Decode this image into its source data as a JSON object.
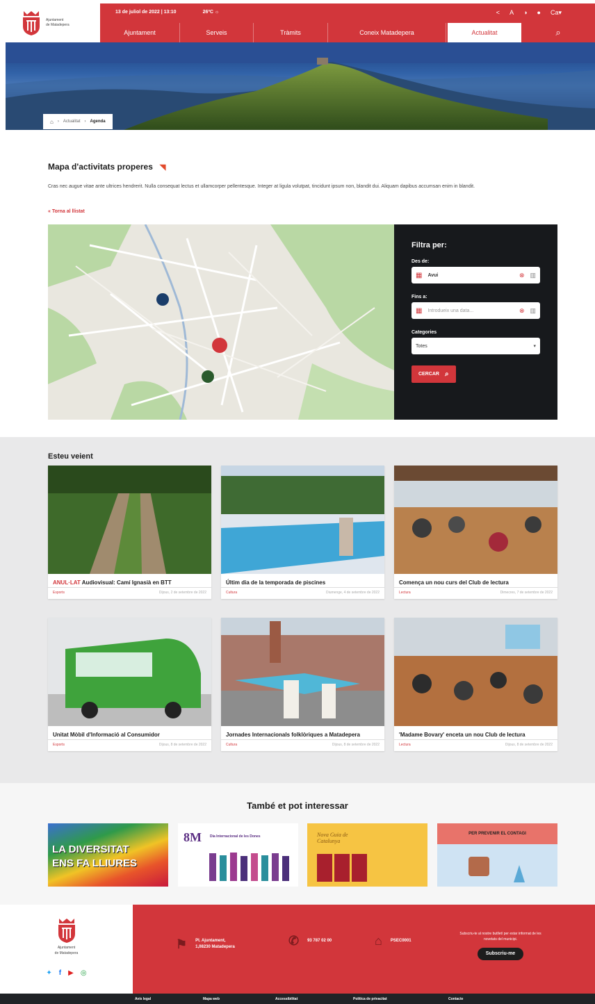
{
  "header": {
    "logo_text": [
      "Ajuntament",
      "de Matadepera"
    ],
    "date": "13 de juliol de 2022 | 13:10",
    "weather": "26ºC",
    "lang": "Ca",
    "nav": [
      "Ajuntament",
      "Serveis",
      "Tràmits",
      "Coneix Matadepera",
      "Actualitat"
    ],
    "active_nav": "Actualitat"
  },
  "breadcrumb": [
    "Actualitat",
    "Agenda"
  ],
  "map_section": {
    "title": "Mapa d'activitats properes",
    "description": "Cras nec augue vitae ante ultrices hendrerit. Nulla consequat lectus et ullamcorper pellentesque. Integer at ligula volutpat, tincidunt ipsum non, blandit dui. Aliquam dapibus accumsan enim in blandit.",
    "back_link": "« Torna al llistat"
  },
  "filter": {
    "title": "Filtra per:",
    "from_label": "Des de:",
    "from_value": "Avui",
    "to_label": "Fins a:",
    "to_placeholder": "Introdueix una data...",
    "categories_label": "Categories",
    "categories_value": "Totes",
    "search_button": "CERCAR"
  },
  "seeing": {
    "title": "Esteu veient",
    "cards": [
      {
        "tag": "ANUL·LAT",
        "title": "Audiovisual: Camí Ignasià en BTT",
        "category": "Esports",
        "date": "Dijous, 2 de setembre de 2022"
      },
      {
        "tag": "",
        "title": "Últim dia de la temporada de piscines",
        "category": "Cultura",
        "date": "Diumenge, 4 de setembre de 2022"
      },
      {
        "tag": "",
        "title": "Comença un nou curs del Club de lectura",
        "category": "Lectura",
        "date": "Dimecres, 7 de setembre de 2022"
      },
      {
        "tag": "",
        "title": "Unitat Mòbil d'Informació al Consumidor",
        "category": "Esports",
        "date": "Dijous, 8 de setembre de 2022"
      },
      {
        "tag": "",
        "title": "Jornades Internacionals folklòriques a Matadepera",
        "category": "Cultura",
        "date": "Dijous, 8 de setembre de 2022"
      },
      {
        "tag": "",
        "title": "'Madame Bovary' enceta un nou Club de lectura",
        "category": "Lectura",
        "date": "Dijous, 8 de setembre de 2022"
      }
    ]
  },
  "interest": {
    "title": "També et pot interessar",
    "promos": [
      {
        "text": [
          "LA DIVERSITAT",
          "ENS FA LLIURES"
        ]
      },
      {
        "text": [
          "8M",
          "Dia Internacional de les Dones"
        ]
      },
      {
        "text": [
          "Nova Guia de Catalunya"
        ]
      },
      {
        "text": [
          "PER PREVENIR EL CONTAGI"
        ]
      }
    ]
  },
  "footer": {
    "logo_text": [
      "Ajuntament",
      "de Matadepera"
    ],
    "address": [
      "Pl. Ajuntament,",
      "1,08230 Matadepera"
    ],
    "phone": "93 787 02 00",
    "register": "PSEC0001",
    "newsletter_text": "Subscriu-te al nostre butlletí per estar informat de les novetats del municipi.",
    "subscribe_button": "Subscriu-me",
    "bottom_links": [
      "Avís legal",
      "Mapa web",
      "Accessibilitat",
      "Política de privacitat",
      "Contacte"
    ]
  },
  "colors": {
    "brand": "#d2363b",
    "dark": "#17191c"
  }
}
